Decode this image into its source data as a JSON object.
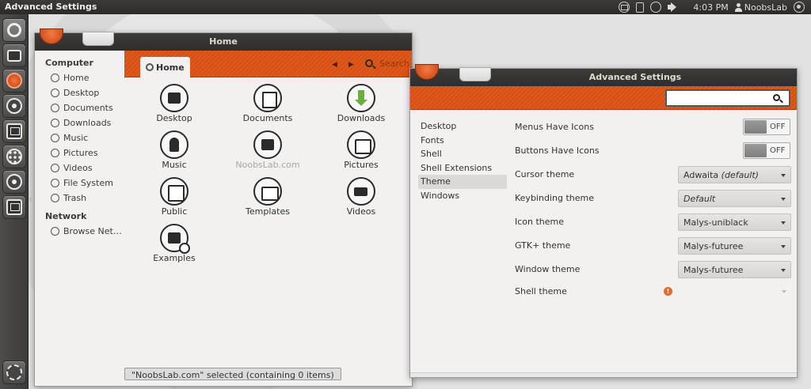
{
  "top_panel": {
    "title": "Advanced Settings",
    "time": "4:03 PM",
    "user": "NoobsLab"
  },
  "launcher": {
    "items": [
      "dash-home",
      "files",
      "ubuntu-one",
      "media-reel",
      "screen",
      "apps-grid",
      "media-reel-2",
      "workspaces",
      "trash"
    ]
  },
  "files": {
    "title": "Home",
    "breadcrumb": "Home",
    "search_label": "Search",
    "sidebar": {
      "computer_heading": "Computer",
      "computer_items": [
        "Home",
        "Desktop",
        "Documents",
        "Downloads",
        "Music",
        "Pictures",
        "Videos",
        "File System",
        "Trash"
      ],
      "network_heading": "Network",
      "network_items": [
        "Browse Net…"
      ]
    },
    "items": [
      {
        "label": "Desktop",
        "icon": "desktop"
      },
      {
        "label": "Documents",
        "icon": "docs"
      },
      {
        "label": "Downloads",
        "icon": "download"
      },
      {
        "label": "Music",
        "icon": "music"
      },
      {
        "label": "NoobsLab.com",
        "icon": "folder"
      },
      {
        "label": "Pictures",
        "icon": "pictures"
      },
      {
        "label": "Public",
        "icon": "public"
      },
      {
        "label": "Templates",
        "icon": "templates"
      },
      {
        "label": "Videos",
        "icon": "videos"
      },
      {
        "label": "Examples",
        "icon": "examples"
      }
    ],
    "status": "\"NoobsLab.com\" selected (containing 0 items)"
  },
  "tweak": {
    "title": "Advanced Settings",
    "search_value": "",
    "nav": [
      "Desktop",
      "Fonts",
      "Shell",
      "Shell Extensions",
      "Theme",
      "Windows"
    ],
    "nav_selected": "Theme",
    "rows": [
      {
        "label": "Menus Have Icons",
        "type": "toggle",
        "value": "OFF"
      },
      {
        "label": "Buttons Have Icons",
        "type": "toggle",
        "value": "OFF"
      },
      {
        "label": "Cursor theme",
        "type": "combo",
        "value": "Adwaita",
        "value_suffix": "(default)"
      },
      {
        "label": "Keybinding theme",
        "type": "combo",
        "value": "",
        "value_suffix": "Default"
      },
      {
        "label": "Icon theme",
        "type": "combo",
        "value": "Malys-uniblack",
        "value_suffix": ""
      },
      {
        "label": "GTK+ theme",
        "type": "combo",
        "value": "Malys-futuree",
        "value_suffix": ""
      },
      {
        "label": "Window theme",
        "type": "combo",
        "value": "Malys-futuree",
        "value_suffix": ""
      },
      {
        "label": "Shell theme",
        "type": "combo-warning",
        "value": "",
        "value_suffix": "",
        "warning": "!"
      }
    ]
  },
  "colors": {
    "accent": "#dd4814",
    "panel": "#3c3b37",
    "window_bg": "#f2f1f0"
  }
}
